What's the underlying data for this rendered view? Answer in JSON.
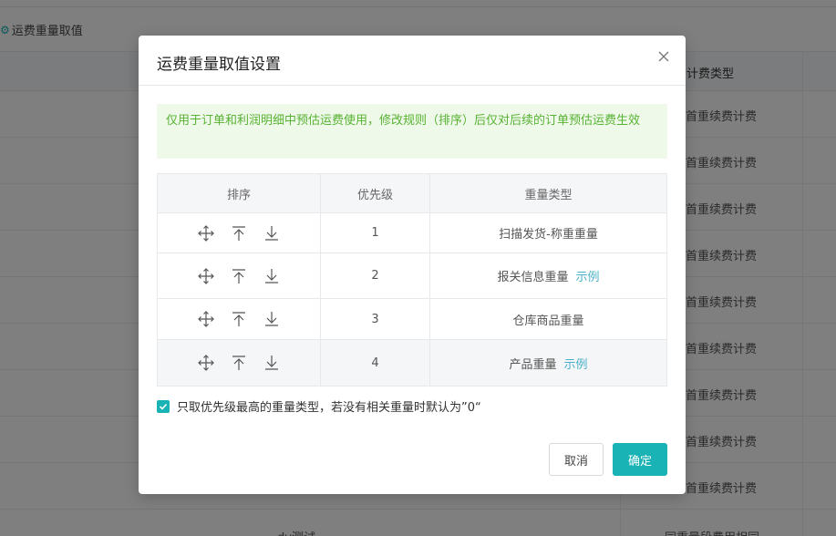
{
  "background": {
    "breadcrumb_label": "运费重量取值",
    "column_header": "计费类型",
    "row_values": [
      "首重续费计费",
      "首重续费计费",
      "首重续费计费",
      "首重续费计费",
      "首重续费计费",
      "首重续费计费",
      "首重续费计费",
      "首重续费计费",
      "首重续费计费"
    ],
    "last_row_left": "dy测试",
    "last_row_right": "同重量段费用相同"
  },
  "modal": {
    "title": "运费重量取值设置",
    "notice": "仅用于订单和利润明细中预估运费使用，修改规则（排序）后仅对后续的订单预估运费生效",
    "table": {
      "headers": [
        "排序",
        "优先级",
        "重量类型"
      ],
      "rows": [
        {
          "priority": "1",
          "weight_type": "扫描发货-称重重量",
          "link": ""
        },
        {
          "priority": "2",
          "weight_type": "报关信息重量",
          "link": "示例"
        },
        {
          "priority": "3",
          "weight_type": "仓库商品重量",
          "link": ""
        },
        {
          "priority": "4",
          "weight_type": "产品重量",
          "link": "示例"
        }
      ]
    },
    "checkbox_label": "只取优先级最高的重量类型，若没有相关重量时默认为”0“",
    "checkbox_checked": true,
    "cancel_label": "取消",
    "confirm_label": "确定"
  },
  "colors": {
    "accent": "#19b3b5",
    "notice_bg": "#eef9ea",
    "notice_text": "#58b232",
    "link": "#4ab0c9"
  },
  "icons": [
    "gear-icon",
    "close-icon",
    "move-icon",
    "move-to-top-icon",
    "move-down-icon",
    "checkmark-icon"
  ]
}
